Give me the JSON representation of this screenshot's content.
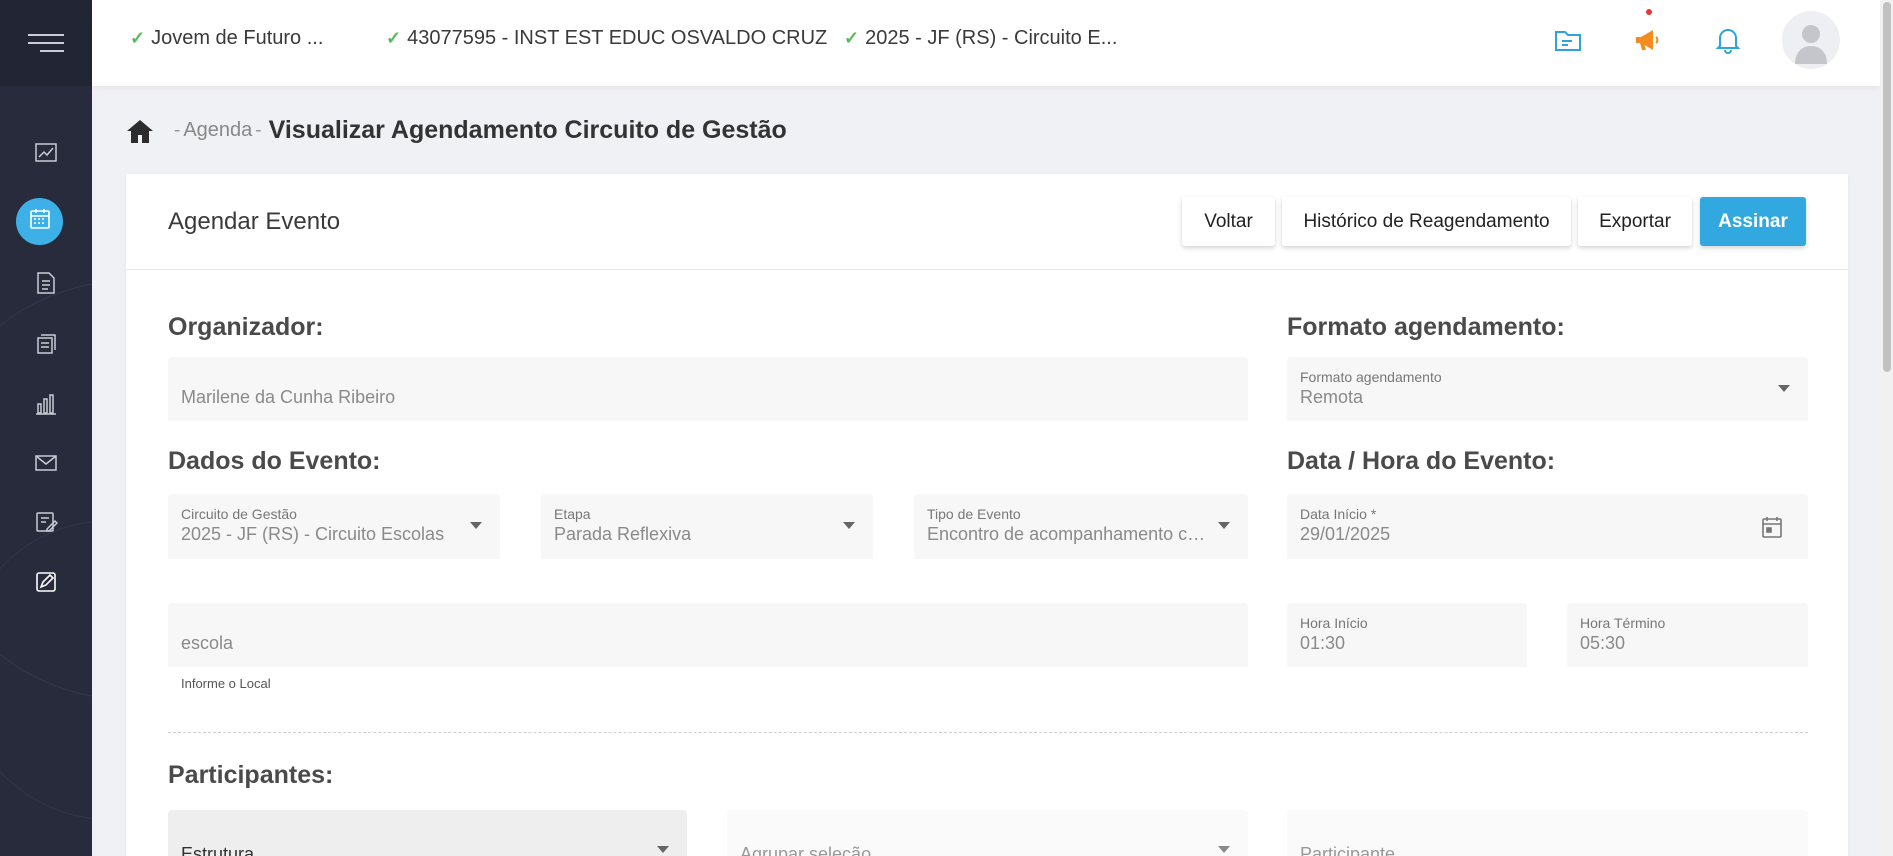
{
  "sidebar": {
    "menu_icon": "hamburger-icon",
    "items": [
      {
        "icon": "chart-line-icon"
      },
      {
        "icon": "calendar-icon",
        "active": true
      },
      {
        "icon": "document-list-icon"
      },
      {
        "icon": "files-icon"
      },
      {
        "icon": "bar-chart-icon"
      },
      {
        "icon": "mail-icon"
      },
      {
        "icon": "edit-form-icon"
      },
      {
        "icon": "pen-sign-icon"
      }
    ]
  },
  "topbar": {
    "selector_program": "Jovem de Futuro ...",
    "selector_school": "43077595 - INST EST EDUC OSVALDO CRUZ",
    "selector_circuit": "2025 - JF (RS) - Circuito E...",
    "icons": [
      "folder-icon",
      "megaphone-icon",
      "bell-icon",
      "user-avatar-icon"
    ]
  },
  "breadcrumb": {
    "home_icon": "home-icon",
    "sep1": "-",
    "agenda": "Agenda",
    "sep2": "-",
    "title": "Visualizar Agendamento Circuito de Gestão"
  },
  "card": {
    "title": "Agendar Evento",
    "buttons": {
      "voltar": "Voltar",
      "historico": "Histórico de Reagendamento",
      "exportar": "Exportar",
      "assinar": "Assinar"
    }
  },
  "form": {
    "organizador_heading": "Organizador:",
    "organizador_value": "Marilene da Cunha Ribeiro",
    "formato_heading": "Formato agendamento:",
    "formato_label": "Formato agendamento",
    "formato_value": "Remota",
    "dados_heading": "Dados do Evento:",
    "circuito_label": "Circuito de Gestão",
    "circuito_value": "2025 - JF (RS) - Circuito Escolas",
    "etapa_label": "Etapa",
    "etapa_value": "Parada Reflexiva",
    "tipo_label": "Tipo de Evento",
    "tipo_value": "Encontro de acompanhamento co...",
    "datahora_heading": "Data / Hora do Evento:",
    "data_inicio_label": "Data Início *",
    "data_inicio_value": "29/01/2025",
    "local_value": "escola",
    "local_hint": "Informe o Local",
    "hora_inicio_label": "Hora Início",
    "hora_inicio_value": "01:30",
    "hora_termino_label": "Hora Término",
    "hora_termino_value": "05:30",
    "participantes_heading": "Participantes:",
    "estrutura_placeholder": "Estrutura",
    "agrupar_placeholder": "Agrupar seleção",
    "participante_placeholder": "Participante"
  },
  "colors": {
    "sidebar_bg": "#272b3b",
    "accent": "#31a9e0",
    "check_green": "#5cb85c",
    "megaphone_orange": "#f28c1e"
  }
}
